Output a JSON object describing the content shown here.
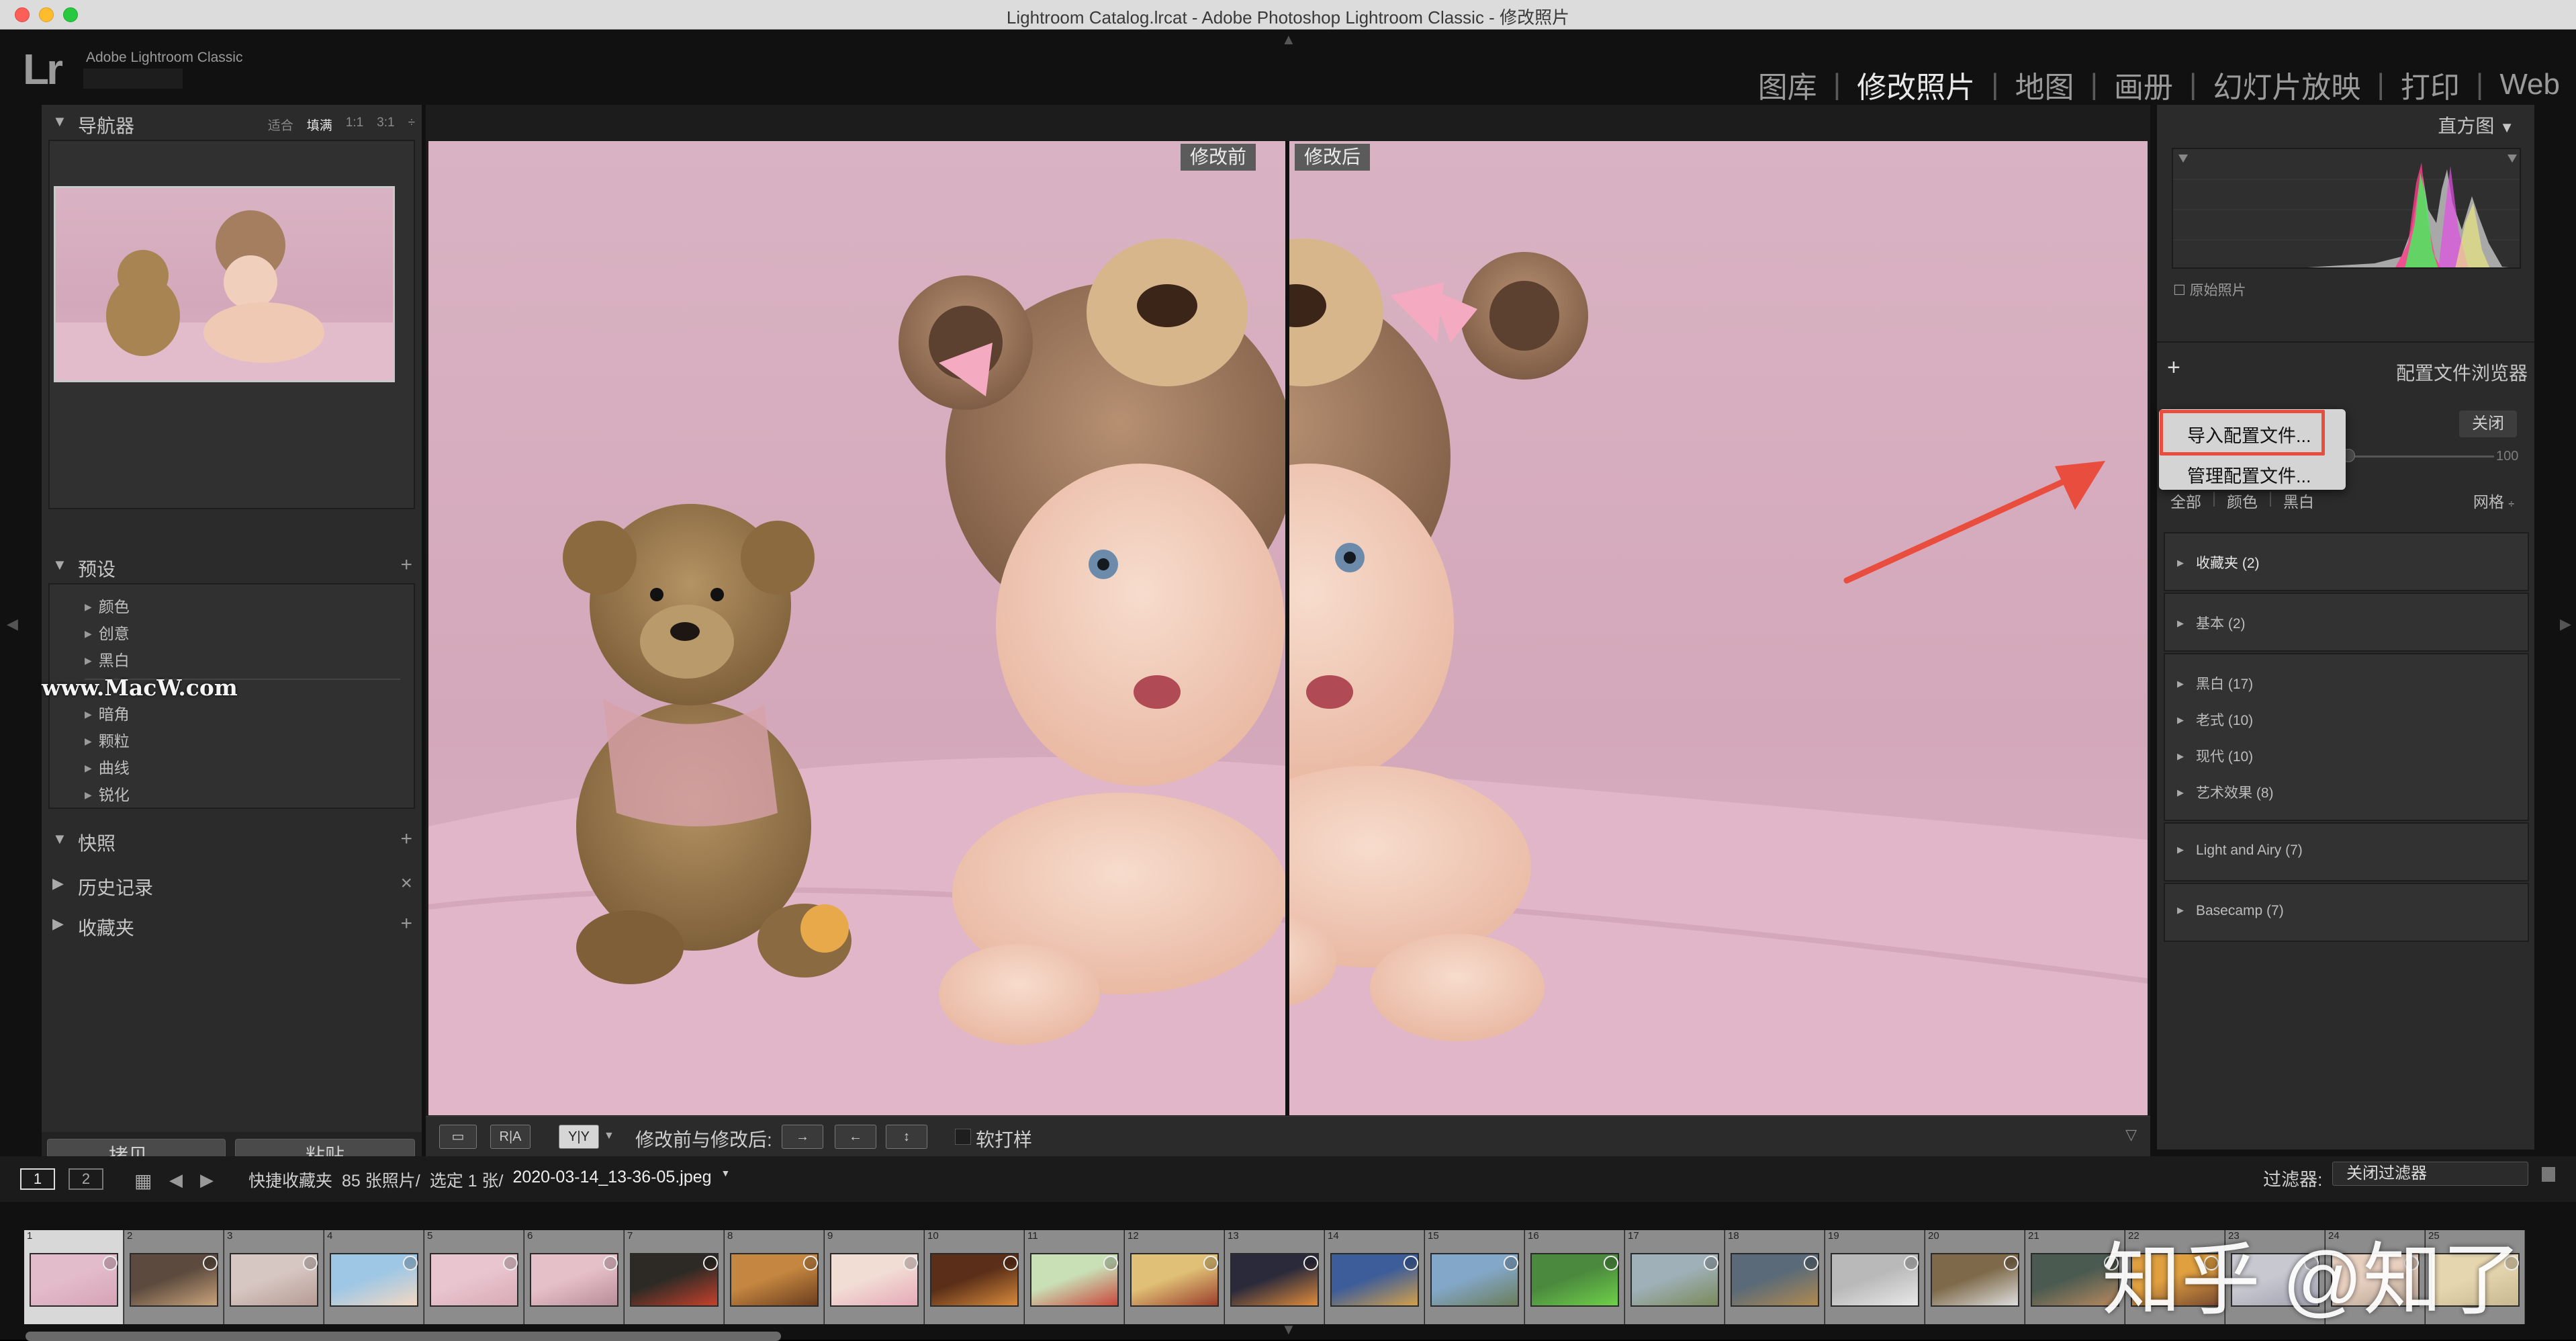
{
  "window": {
    "title": "Lightroom Catalog.lrcat - Adobe Photoshop Lightroom Classic - 修改照片"
  },
  "identity": {
    "logo": "Lr",
    "app_name": "Adobe Lightroom Classic"
  },
  "modules": {
    "items": [
      "图库",
      "修改照片",
      "地图",
      "画册",
      "幻灯片放映",
      "打印",
      "Web"
    ],
    "separator": "|",
    "active": "修改照片"
  },
  "left_panel": {
    "navigator": {
      "title": "导航器",
      "options": [
        "适合",
        "填满",
        "1:1",
        "3:1"
      ],
      "selected": "填满",
      "more": "÷"
    },
    "presets": {
      "title": "预设",
      "plus": "+",
      "items": [
        "颜色",
        "创意",
        "黑白",
        "暗角",
        "颗粒",
        "曲线",
        "锐化"
      ]
    },
    "snapshots": {
      "title": "快照",
      "plus": "+"
    },
    "history": {
      "title": "历史记录",
      "close": "×"
    },
    "collections": {
      "title": "收藏夹",
      "plus": "+"
    },
    "copy_button": "拷贝...",
    "paste_button": "粘贴"
  },
  "watermark": "www.MacW.com",
  "center": {
    "before_tag": "修改前",
    "after_tag": "修改后"
  },
  "toolbar": {
    "view_label": "修改前与修改后:",
    "soft_proof": "软打样",
    "ya_button": "Y|Y",
    "ra_button": "R|A",
    "swap1": "→",
    "swap2": "←",
    "swap3": "↕"
  },
  "right_panel": {
    "histogram": {
      "title": "直方图",
      "original_photo": "原始照片"
    },
    "profile_browser": {
      "title": "配置文件浏览器",
      "plus": "+",
      "close_button": "关闭",
      "amount": "100",
      "filters": [
        "全部",
        "颜色",
        "黑白"
      ],
      "filter_separator": "|",
      "grid": "网格",
      "groups": [
        {
          "items": [
            "收藏夹 (2)"
          ]
        },
        {
          "items": [
            "基本 (2)"
          ]
        },
        {
          "items": [
            "黑白 (17)",
            "老式 (10)",
            "现代 (10)",
            "艺术效果 (8)"
          ]
        },
        {
          "items": [
            "Light and Airy (7)"
          ]
        },
        {
          "items": [
            "Basecamp (7)"
          ]
        }
      ]
    }
  },
  "popup_menu": {
    "items": [
      "导入配置文件...",
      "管理配置文件..."
    ]
  },
  "filmstrip_bar": {
    "page1": "1",
    "page2": "2",
    "source": "快捷收藏夹",
    "count": "85 张照片/",
    "selected": "选定 1 张/",
    "filename": "2020-03-14_13-36-05.jpeg",
    "filter_label": "过滤器:",
    "filter_value": "关闭过滤器"
  },
  "filmstrip": {
    "numbers": [
      "1",
      "2",
      "3",
      "4",
      "5",
      "6",
      "7",
      "8",
      "9",
      "10",
      "11",
      "12",
      "13",
      "14",
      "15",
      "16",
      "17",
      "18",
      "19",
      "20",
      "21",
      "22",
      "23",
      "24",
      "25"
    ],
    "selected_index": 0
  },
  "zhihu_watermark": "知乎 @知了",
  "colors": {
    "accent_red": "#e94d3d",
    "panel_bg": "#2b2b2b",
    "photo_pink": "#d6abbe"
  }
}
